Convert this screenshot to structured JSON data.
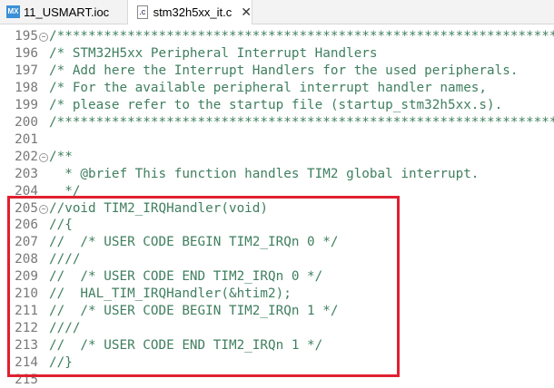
{
  "tabs": [
    {
      "label": "11_USMART.ioc",
      "icon": "MX"
    },
    {
      "label": "stm32h5xx_it.c",
      "icon": ".c",
      "active": true
    }
  ],
  "lines": [
    {
      "n": "195",
      "fold": true,
      "t": "/*******************************************************************"
    },
    {
      "n": "196",
      "t": "/* STM32H5xx Peripheral Interrupt Handlers"
    },
    {
      "n": "197",
      "t": "/* Add here the Interrupt Handlers for the used peripherals."
    },
    {
      "n": "198",
      "t": "/* For the available peripheral interrupt handler names,"
    },
    {
      "n": "199",
      "t": "/* please refer to the startup file (startup_stm32h5xx.s)."
    },
    {
      "n": "200",
      "t": "/*******************************************************************"
    },
    {
      "n": "201",
      "t": ""
    },
    {
      "n": "202",
      "fold": true,
      "t": "/**"
    },
    {
      "n": "203",
      "t": "  * @brief This function handles TIM2 global interrupt."
    },
    {
      "n": "204",
      "t": "  */"
    },
    {
      "n": "205",
      "fold": true,
      "t": "//void TIM2_IRQHandler(void)"
    },
    {
      "n": "206",
      "t": "//{"
    },
    {
      "n": "207",
      "t": "//  /* USER CODE BEGIN TIM2_IRQn 0 */"
    },
    {
      "n": "208",
      "t": "////"
    },
    {
      "n": "209",
      "t": "//  /* USER CODE END TIM2_IRQn 0 */"
    },
    {
      "n": "210",
      "t": "//  HAL_TIM_IRQHandler(&htim2);"
    },
    {
      "n": "211",
      "t": "//  /* USER CODE BEGIN TIM2_IRQn 1 */"
    },
    {
      "n": "212",
      "t": "////"
    },
    {
      "n": "213",
      "t": "//  /* USER CODE END TIM2_IRQn 1 */"
    },
    {
      "n": "214",
      "t": "//}"
    },
    {
      "n": "215",
      "t": ""
    }
  ]
}
